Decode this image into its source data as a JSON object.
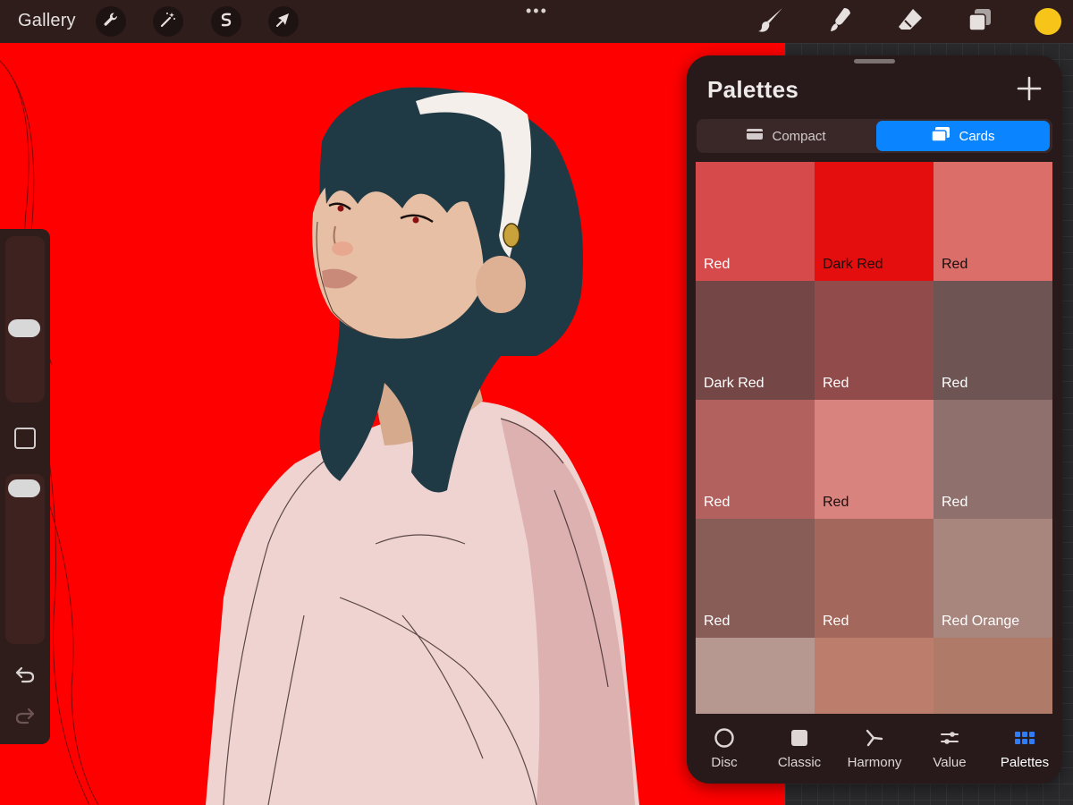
{
  "topbar": {
    "gallery_label": "Gallery",
    "dots": "•••",
    "left_tools": [
      "wrench-icon",
      "magic-wand-icon",
      "selection-s-icon",
      "transform-arrow-icon"
    ],
    "right_tools": [
      "brush-icon",
      "smudge-icon",
      "eraser-icon",
      "layers-icon"
    ],
    "current_color": "#f7c41a"
  },
  "canvas": {
    "background_color": "#ff0000"
  },
  "sidebar": {
    "size_slider_level": 0.55,
    "opacity_slider_level": 0.95,
    "undo_icon": "undo-icon",
    "redo_icon": "redo-icon"
  },
  "palette_panel": {
    "title": "Palettes",
    "view_modes": [
      {
        "label": "Compact",
        "active": false
      },
      {
        "label": "Cards",
        "active": true
      }
    ],
    "swatches": [
      {
        "name": "Red",
        "color": "#d64a4b",
        "text": "#ffffff"
      },
      {
        "name": "Dark Red",
        "color": "#e30e0d",
        "text": "#1a0d0d"
      },
      {
        "name": "Red",
        "color": "#db6e69",
        "text": "#1a0d0d"
      },
      {
        "name": "Dark Red",
        "color": "#744645",
        "text": "#ffffff"
      },
      {
        "name": "Red",
        "color": "#924b4b",
        "text": "#ffffff"
      },
      {
        "name": "Red",
        "color": "#6e5553",
        "text": "#ffffff"
      },
      {
        "name": "Red",
        "color": "#b2615f",
        "text": "#ffffff"
      },
      {
        "name": "Red",
        "color": "#d9837e",
        "text": "#1a0d0d"
      },
      {
        "name": "Red",
        "color": "#8f706c",
        "text": "#ffffff"
      },
      {
        "name": "Red",
        "color": "#895d57",
        "text": "#ffffff"
      },
      {
        "name": "Red",
        "color": "#a4675c",
        "text": "#ffffff"
      },
      {
        "name": "Red Orange",
        "color": "#a8867d",
        "text": "#ffffff"
      },
      {
        "name": "",
        "color": "#b79890",
        "text": "#ffffff"
      },
      {
        "name": "",
        "color": "#bd7d6d",
        "text": "#ffffff"
      },
      {
        "name": "",
        "color": "#af7a67",
        "text": "#ffffff"
      }
    ],
    "tabs": [
      {
        "label": "Disc",
        "icon": "disc-icon",
        "active": false
      },
      {
        "label": "Classic",
        "icon": "classic-square-icon",
        "active": false
      },
      {
        "label": "Harmony",
        "icon": "harmony-icon",
        "active": false
      },
      {
        "label": "Value",
        "icon": "value-sliders-icon",
        "active": false
      },
      {
        "label": "Palettes",
        "icon": "palettes-grid-icon",
        "active": true
      }
    ]
  }
}
